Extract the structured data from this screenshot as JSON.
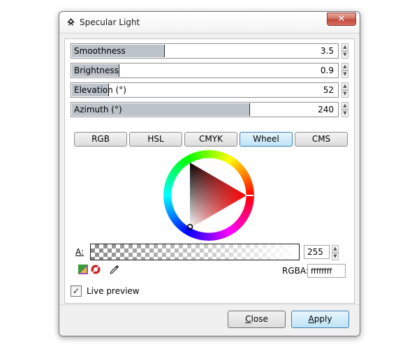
{
  "window": {
    "title": "Specular Light",
    "close_glyph": "✕"
  },
  "sliders": [
    {
      "label": "Smoothness",
      "value": "3.5",
      "fill_fraction": 0.35
    },
    {
      "label": "Brightness",
      "value": "0.9",
      "fill_fraction": 0.18
    },
    {
      "label": "Elevation (°)",
      "value": "52",
      "fill_fraction": 0.14
    },
    {
      "label": "Azimuth (°)",
      "value": "240",
      "fill_fraction": 0.67
    }
  ],
  "spin_icons": {
    "up": "▲",
    "down": "▼"
  },
  "color_tabs": [
    {
      "label": "RGB",
      "active": false
    },
    {
      "label": "HSL",
      "active": false
    },
    {
      "label": "CMYK",
      "active": false
    },
    {
      "label": "Wheel",
      "active": true
    },
    {
      "label": "CMS",
      "active": false
    }
  ],
  "color_wheel": {
    "hue_color": "#ff0000"
  },
  "alpha": {
    "label": "A:",
    "value": "255",
    "level": 1.0
  },
  "tools": [
    "out-of-gamut-icon",
    "too-much-ink-icon",
    "color-picker-icon"
  ],
  "rgba": {
    "label": "RGBA:",
    "value": "ffffffff"
  },
  "live_preview": {
    "label": "Live preview",
    "checked": true,
    "check_glyph": "✓"
  },
  "buttons": {
    "close": {
      "label": "Close",
      "underline": "C",
      "rest": "lose"
    },
    "apply": {
      "label": "Apply",
      "underline": "A",
      "rest": "pply"
    }
  }
}
